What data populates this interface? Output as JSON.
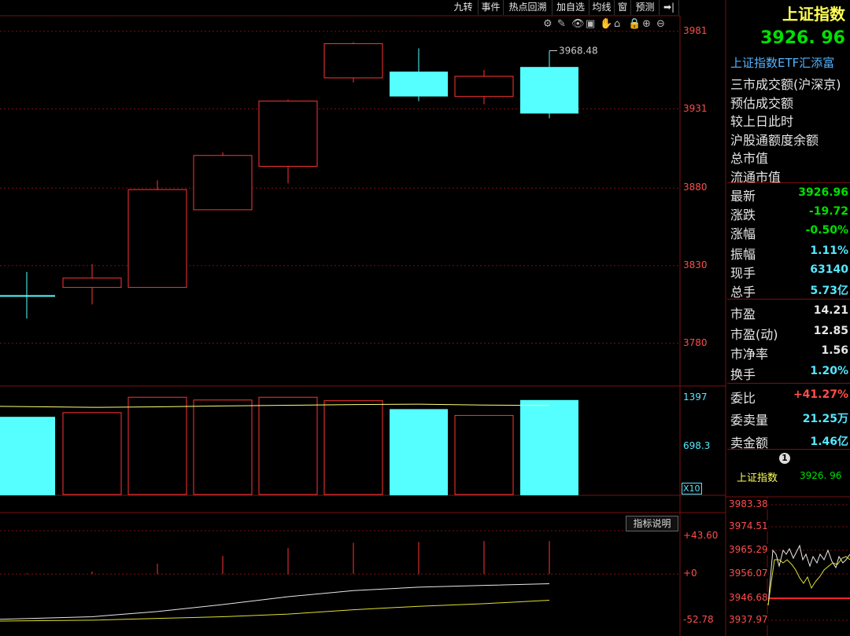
{
  "toolbar": [
    "九转",
    "事件",
    "热点回溯",
    "加自选",
    "均线",
    "窗",
    "预测",
    "➡|"
  ],
  "chart_tools": [
    "settings-icon",
    "brush-icon",
    "eye-icon",
    "lock-icon",
    "hand-icon",
    "home-icon",
    "lock2-icon",
    "zoom-in-icon",
    "zoom-out-icon"
  ],
  "panel": {
    "title": "上证指数",
    "price": "3926. 96",
    "etf": "上证指数ETF汇添富",
    "info_rows": [
      "三市成交额(沪深京)",
      "预估成交额",
      "较上日此时",
      "沪股通额度余额",
      "总市值",
      "流通市值"
    ],
    "quotes": [
      {
        "label": "最新",
        "value": "3926.96",
        "color": "#00e000"
      },
      {
        "label": "涨跌",
        "value": "-19.72",
        "color": "#00e000"
      },
      {
        "label": "涨幅",
        "value": "-0.50%",
        "color": "#00e000"
      },
      {
        "label": "振幅",
        "value": "1.11%",
        "color": "#55e8ff"
      },
      {
        "label": "现手",
        "value": "63140",
        "color": "#55e8ff"
      },
      {
        "label": "总手",
        "value": "5.73亿",
        "color": "#55e8ff"
      },
      {
        "label": "市盈",
        "value": "14.21",
        "color": "#e6e6e6"
      },
      {
        "label": "市盈(动)",
        "value": "12.85",
        "color": "#e6e6e6"
      },
      {
        "label": "市净率",
        "value": "1.56",
        "color": "#e6e6e6"
      },
      {
        "label": "换手",
        "value": "1.20%",
        "color": "#55e8ff"
      },
      {
        "label": "委比",
        "value": "+41.27%",
        "color": "#ff4d4d"
      },
      {
        "label": "委卖量",
        "value": "21.25万",
        "color": "#55e8ff"
      },
      {
        "label": "卖金额",
        "value": "1.46亿",
        "color": "#55e8ff"
      }
    ],
    "marker_number": "1",
    "mini_name": "上证指数",
    "mini_price": "3926. 96"
  },
  "indicator_button": "指标说明",
  "mini_axis": [
    "3983.38",
    "3974.51",
    "3965.29",
    "3956.07",
    "3946.68",
    "3937.97"
  ],
  "colors": {
    "up": "#ff3333",
    "down": "#55ffff",
    "grid": "#7a1010",
    "label": "#ff4d4d"
  },
  "chart_data": {
    "type": "candlestick",
    "price_axis": {
      "ticks": [
        "3981",
        "3931",
        "3880",
        "3830",
        "3780"
      ],
      "range": [
        3754,
        3990
      ]
    },
    "high_label": "3968.48",
    "candles": [
      {
        "open": 3811,
        "close": 3811,
        "high": 3826,
        "low": 3796,
        "dir": "down"
      },
      {
        "open": 3816,
        "close": 3822,
        "high": 3831,
        "low": 3805,
        "dir": "up"
      },
      {
        "open": 3816,
        "close": 3879,
        "high": 3885,
        "low": 3816,
        "dir": "up"
      },
      {
        "open": 3866,
        "close": 3901,
        "high": 3903,
        "low": 3866,
        "dir": "up"
      },
      {
        "open": 3894,
        "close": 3936,
        "high": 3937,
        "low": 3883,
        "dir": "up"
      },
      {
        "open": 3951,
        "close": 3973,
        "high": 3974,
        "low": 3948,
        "dir": "up"
      },
      {
        "open": 3955,
        "close": 3939,
        "high": 3970,
        "low": 3936,
        "dir": "down"
      },
      {
        "open": 3939,
        "close": 3952,
        "high": 3956,
        "low": 3934,
        "dir": "up"
      },
      {
        "open": 3958,
        "close": 3928,
        "high": 3968.48,
        "low": 3925,
        "dir": "down"
      }
    ],
    "volume_axis": {
      "ticks": [
        "1397",
        "698.3"
      ],
      "unit": "X10",
      "range": [
        0,
        1560
      ]
    },
    "volumes": [
      {
        "value": 1120,
        "dir": "down"
      },
      {
        "value": 1180,
        "dir": "up"
      },
      {
        "value": 1400,
        "dir": "up"
      },
      {
        "value": 1360,
        "dir": "up"
      },
      {
        "value": 1400,
        "dir": "up"
      },
      {
        "value": 1350,
        "dir": "up"
      },
      {
        "value": 1230,
        "dir": "down"
      },
      {
        "value": 1140,
        "dir": "up"
      },
      {
        "value": 1360,
        "dir": "down"
      }
    ],
    "volume_ma": [
      1270,
      1255,
      1262,
      1275,
      1285,
      1295,
      1300,
      1288,
      1282
    ],
    "indicator_axis": {
      "ticks": [
        "+43.60",
        "+0",
        "-52.78"
      ],
      "range": [
        -54,
        50
      ]
    },
    "indicator_bars": [
      1,
      3,
      12,
      21,
      30,
      36,
      37,
      38,
      38
    ],
    "indicator_line1": [
      -52,
      -49,
      -43,
      -35,
      -26,
      -19,
      -15,
      -13,
      -11
    ],
    "indicator_line2": [
      -54,
      -53,
      -51,
      -49,
      -46,
      -41,
      -37,
      -34,
      -30
    ]
  }
}
